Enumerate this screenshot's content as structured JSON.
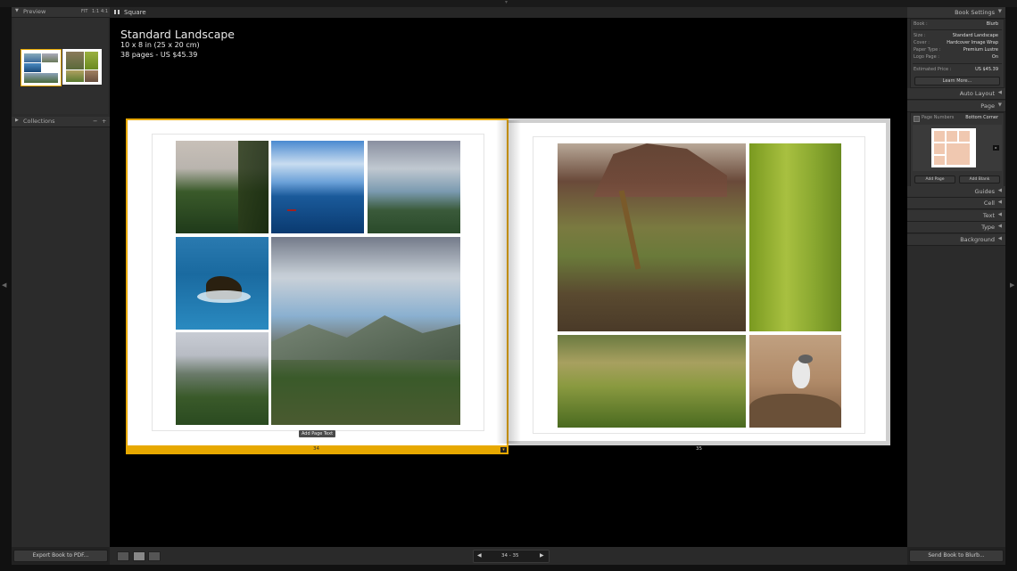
{
  "left_panel": {
    "preview_title": "Preview",
    "zoom_options": [
      "FIT",
      "1:1",
      "4:1"
    ],
    "collections_title": "Collections",
    "collections_minus": "−",
    "collections_plus": "+",
    "export_button": "Export Book to PDF..."
  },
  "center": {
    "view_name": "Square",
    "book_title": "Standard Landscape",
    "book_size": "10 x 8 in (25 x 20 cm)",
    "book_pages_price": "38 pages - US $45.39",
    "add_page_text_button": "Add Page Text",
    "left_page_number": "34",
    "right_page_number": "35",
    "nav_current": "34 - 35",
    "nav_prev": "◀",
    "nav_next": "▶",
    "nav_first": "|◀",
    "nav_last": "▶|"
  },
  "right_panel": {
    "book_settings_title": "Book Settings",
    "book_label": "Book :",
    "book_value": "Blurb",
    "size_label": "Size :",
    "size_value": "Standard Landscape",
    "cover_label": "Cover :",
    "cover_value": "Hardcover Image Wrap",
    "paper_label": "Paper Type :",
    "paper_value": "Premium Lustre",
    "logo_label": "Logo Page :",
    "logo_value": "On",
    "price_label": "Estimated Price :",
    "price_value": "US $45.39",
    "learn_more": "Learn More...",
    "auto_layout_title": "Auto Layout",
    "page_title": "Page",
    "page_numbers_label": "Page Numbers",
    "page_numbers_value": "Bottom Corner",
    "add_page_button": "Add Page",
    "add_blank_button": "Add Blank",
    "guides_title": "Guides",
    "cell_title": "Cell",
    "text_title": "Text",
    "type_title": "Type",
    "background_title": "Background",
    "send_button": "Send Book to Blurb..."
  },
  "colors": {
    "accent_yellow": "#e7a800",
    "panel_bg": "#2b2b2b",
    "canvas_bg": "#000000"
  }
}
